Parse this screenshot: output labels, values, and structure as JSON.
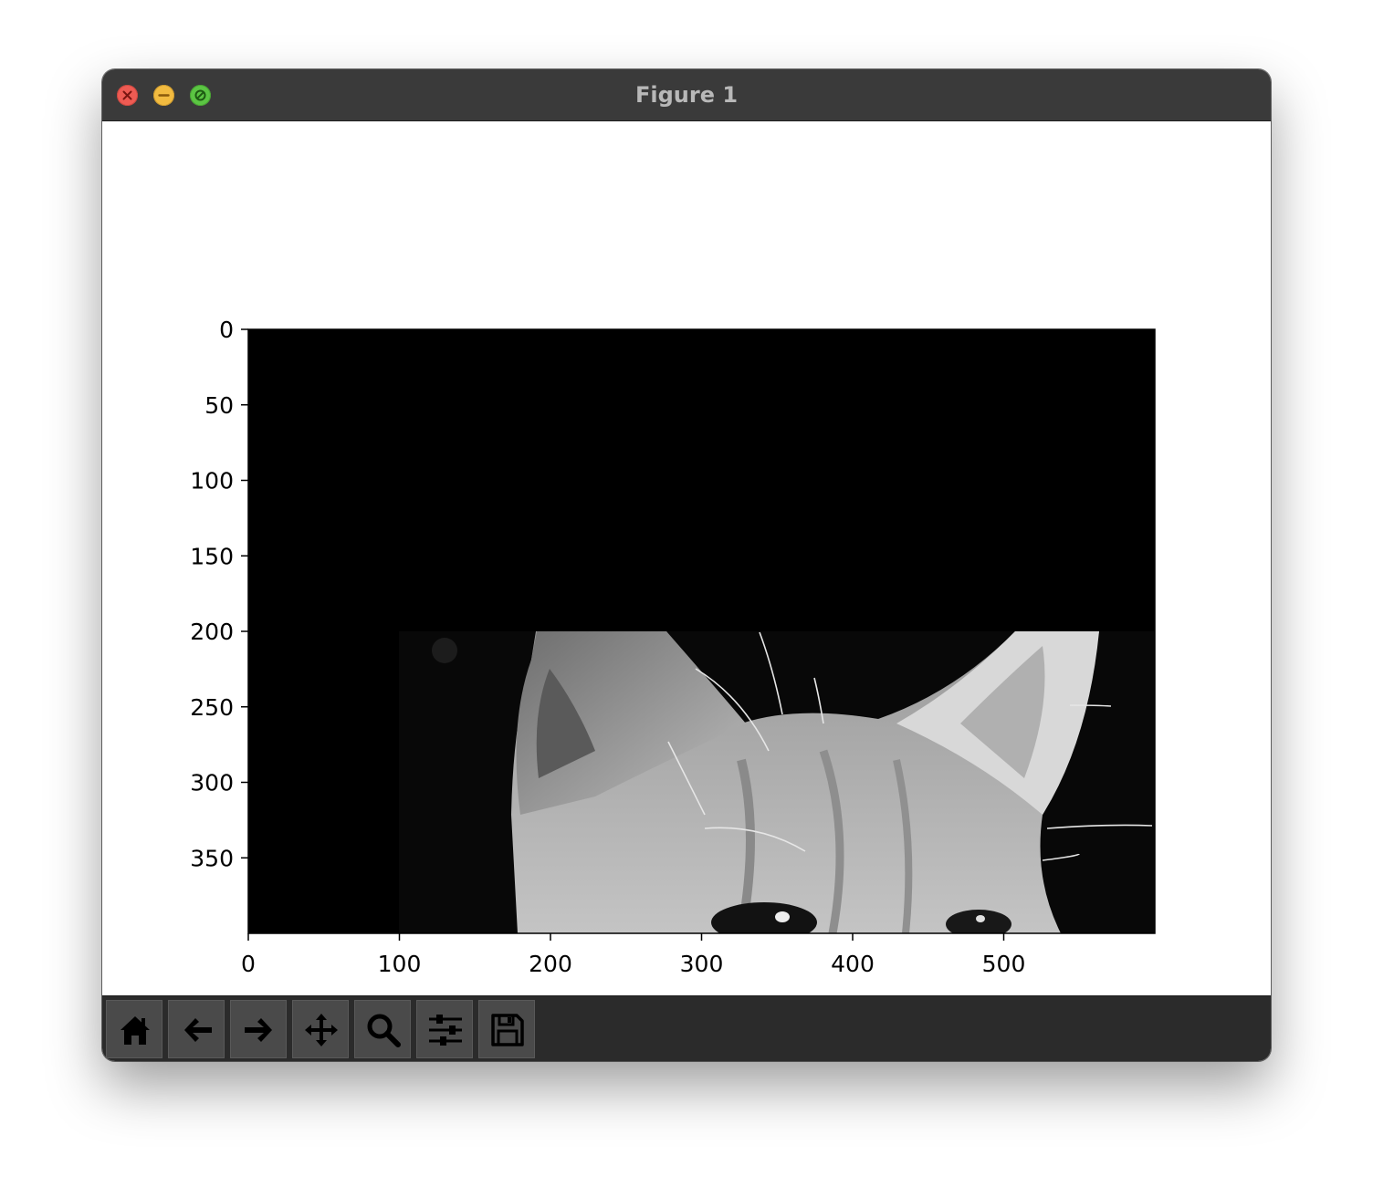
{
  "window": {
    "title": "Figure 1"
  },
  "controls": {
    "close": "close-icon",
    "minimize": "minimize-icon",
    "zoom": "zoom-icon"
  },
  "toolbar": {
    "buttons": [
      {
        "name": "home-button",
        "icon": "home-icon"
      },
      {
        "name": "back-button",
        "icon": "arrow-left-icon"
      },
      {
        "name": "forward-button",
        "icon": "arrow-right-icon"
      },
      {
        "name": "pan-button",
        "icon": "move-icon"
      },
      {
        "name": "zoom-button",
        "icon": "magnifier-icon"
      },
      {
        "name": "configure-subplots-button",
        "icon": "sliders-icon"
      },
      {
        "name": "save-button",
        "icon": "floppy-disk-icon"
      }
    ]
  },
  "chart_data": {
    "type": "image",
    "image_content": "grayscale cat, top of head and ears; upper part of image is black",
    "xlim": [
      0,
      600
    ],
    "ylim": [
      400,
      0
    ],
    "xticks": [
      "0",
      "100",
      "200",
      "300",
      "400",
      "500"
    ],
    "yticks": [
      "0",
      "50",
      "100",
      "150",
      "200",
      "250",
      "300",
      "350"
    ],
    "dark_region_until_y": 200,
    "cat_crop_x_start": 100,
    "colors": {
      "background": "#000000",
      "fur": "#a8a8a8"
    }
  }
}
